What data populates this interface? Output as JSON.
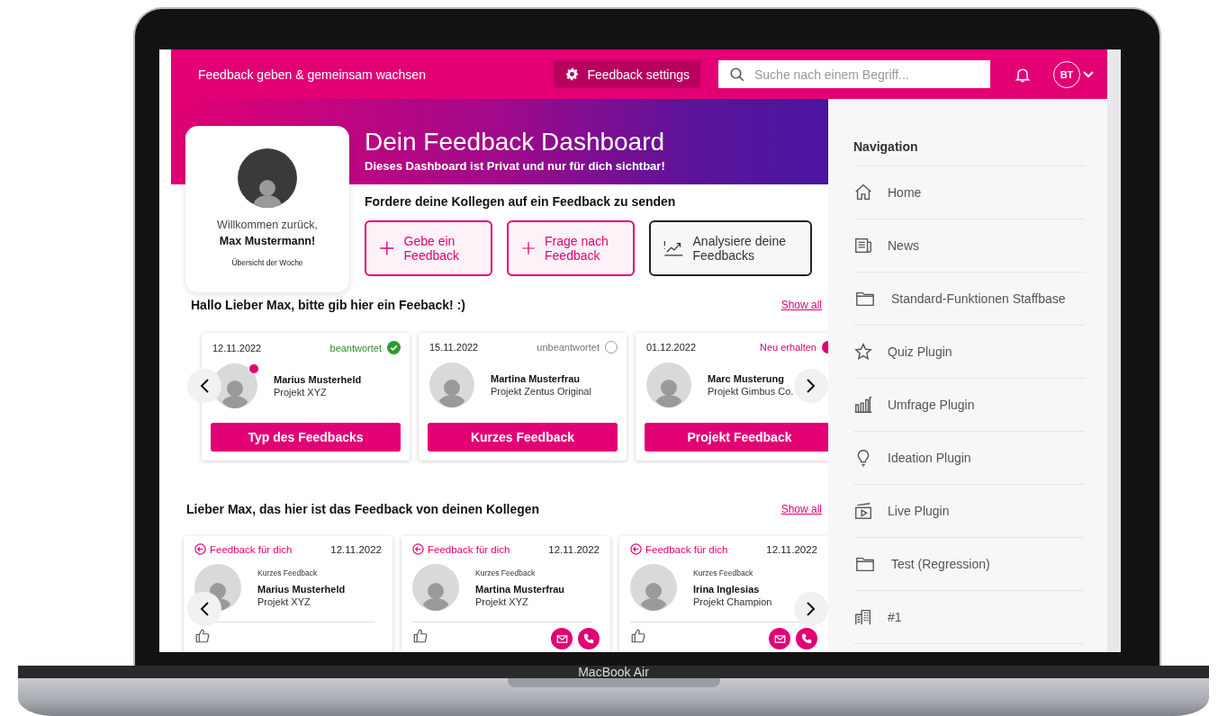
{
  "laptop": {
    "label": "MacBook Air"
  },
  "topbar": {
    "title": "Feedback geben & gemeinsam wachsen",
    "settings_button": "Feedback settings",
    "search": {
      "placeholder": "Suche nach einem Begriff..."
    },
    "avatar_initials": "BT"
  },
  "hero": {
    "title": "Dein Feedback Dashboard",
    "subtitle": "Dieses Dashboard ist Privat und nur für dich sichtbar!"
  },
  "profile": {
    "greeting": "Willkommen zurück,",
    "name": "Max Mustermann!",
    "link": "Übersicht der Woche"
  },
  "request": {
    "heading": "Fordere deine Kollegen auf ein Feedback zu senden",
    "actions": [
      {
        "kind": "add",
        "label": "Gebe ein Feedback"
      },
      {
        "kind": "add",
        "label": "Frage nach Feedback"
      },
      {
        "kind": "analyze",
        "label": "Analysiere deine Feedbacks"
      }
    ]
  },
  "pending": {
    "heading": "Hallo Lieber Max, bitte gib hier ein Feeback! :)",
    "show_all": "Show all",
    "cards": [
      {
        "date": "12.11.2022",
        "kind": "answered",
        "status_label": "beantwortet",
        "notification_dot": true,
        "name": "Marius Musterheld",
        "project": "Projekt XYZ",
        "button": "Typ des Feedbacks"
      },
      {
        "date": "15.11.2022",
        "kind": "unanswered",
        "status_label": "unbeantwortet",
        "notification_dot": false,
        "name": "Martina Musterfrau",
        "project": "Projekt Zentus Original",
        "button": "Kurzes Feedback"
      },
      {
        "date": "01.12.2022",
        "kind": "new",
        "status_label": "Neu erhalten",
        "notification_dot": false,
        "name": "Marc Musterung",
        "project": "Projekt Gimbus Co.",
        "button": "Projekt Feedback"
      }
    ]
  },
  "received": {
    "heading": "Lieber Max, das hier ist das Feedback von deinen Kollegen",
    "show_all": "Show all",
    "cards": [
      {
        "label": "Feedback für dich",
        "date": "12.11.2022",
        "type": "Kurzes Feedback",
        "name": "Marius Musterheld",
        "project": "Projekt XYZ",
        "contact_actions": false
      },
      {
        "label": "Feedback für dich",
        "date": "12.11.2022",
        "type": "Kurzes Feedback",
        "name": "Martina Musterfrau",
        "project": "Projekt XYZ",
        "contact_actions": true
      },
      {
        "label": "Feedback für dich",
        "date": "12.11.2022",
        "type": "Kurzes Feedback",
        "name": "Irina Inglesias",
        "project": "Projekt Champion",
        "contact_actions": true
      }
    ]
  },
  "navigation": {
    "title": "Navigation",
    "items": [
      {
        "kind": "home",
        "label": "Home"
      },
      {
        "kind": "news",
        "label": "News"
      },
      {
        "kind": "folder",
        "label": "Standard-Funktionen Staffbase"
      },
      {
        "kind": "quiz",
        "label": "Quiz Plugin"
      },
      {
        "kind": "survey",
        "label": "Umfrage Plugin"
      },
      {
        "kind": "ideation",
        "label": "Ideation Plugin"
      },
      {
        "kind": "live",
        "label": "Live Plugin"
      },
      {
        "kind": "folder",
        "label": "Test (Regression)"
      },
      {
        "kind": "site",
        "label": "#1"
      }
    ]
  }
}
